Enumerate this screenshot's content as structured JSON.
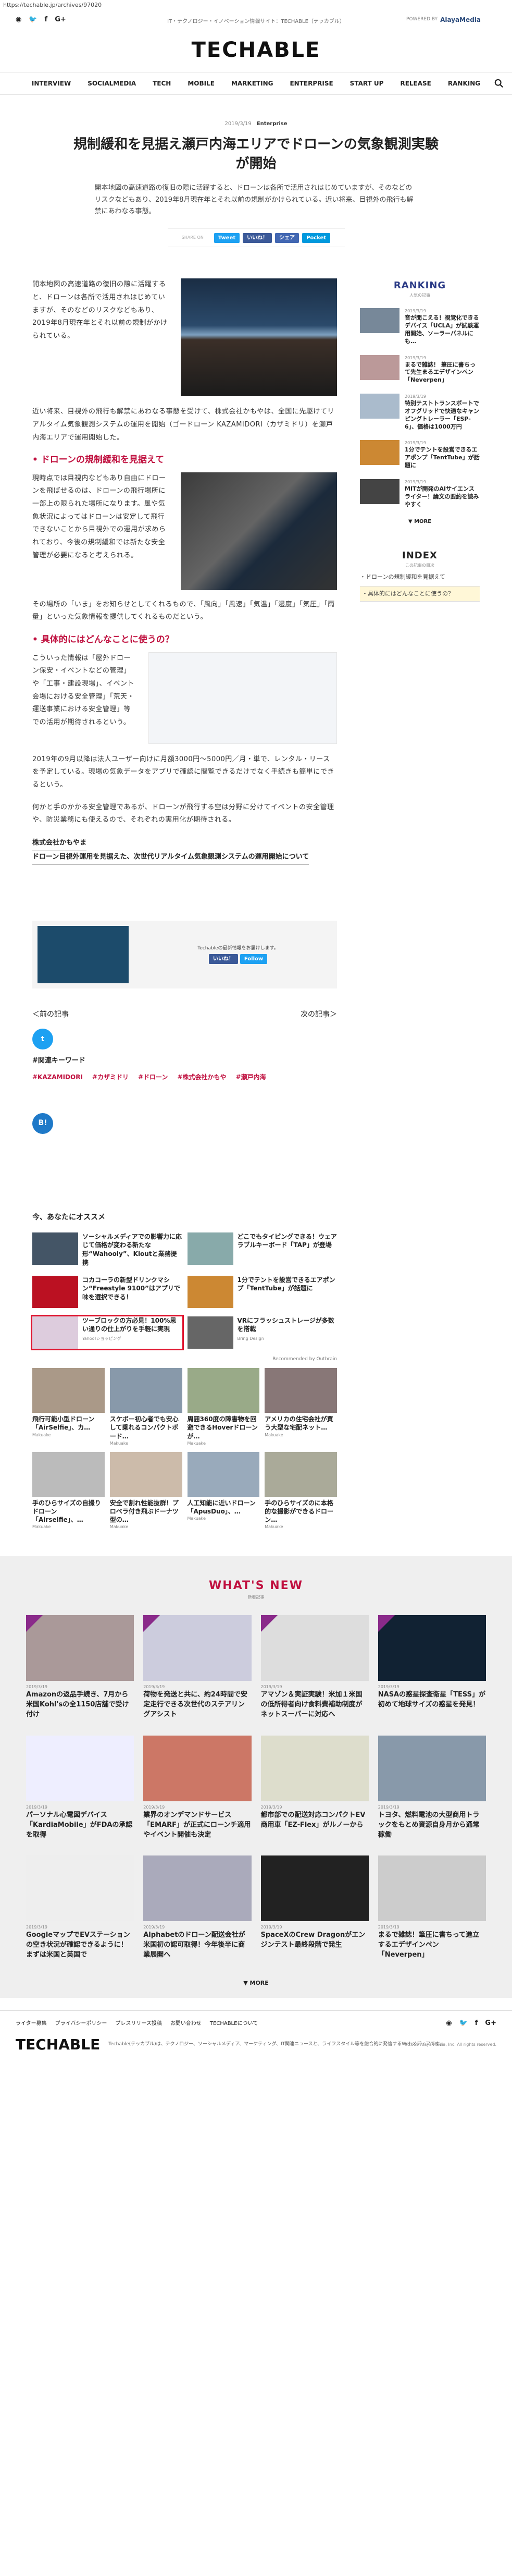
{
  "url": "https://techable.jp/archives/97020",
  "tagline": "IT・テクノロジー・イノベーション情報サイト：TECHABLE（テッカブル）",
  "powered_by": {
    "prefix": "POWERED BY",
    "brand": "AlayaMedia"
  },
  "logo": "TECHABLE",
  "nav": [
    "INTERVIEW",
    "SOCIALMEDIA",
    "TECH",
    "MOBILE",
    "MARKETING",
    "ENTERPRISE",
    "START UP",
    "RELEASE",
    "RANKING"
  ],
  "article": {
    "date": "2019/3/19",
    "category": "Enterprise",
    "title": "規制緩和を見据え瀬戸内海エリアでドローンの気象観測実験が開始",
    "lead": "開本地図の高速道路の復旧の際に活躍すると、ドローンは各所で活用されはじめていますが、そのなどのリスクなどもあり、2019年8月現在年とそれ以前の規制がかけられている。近い将来、目視外の飛行も解禁にあわなる事態。",
    "share_label": "SHARE ON",
    "share_buttons": [
      "Tweet",
      "いいね！",
      "シェア",
      "Pocket"
    ],
    "p1": "開本地図の高速道路の復旧の際に活躍すると、ドローンは各所で活用されはじめていますが、そのなどのリスクなどもあり、2019年8月現在年とそれ以前の規制がかけられている。",
    "p2": "近い将来、目視外の飛行も解禁にあわなる事態を受けて、株式会社かもやは、全国に先駆けてリアルタイム気象観測システムの運用を開始（ゴードローン KAZAMIDORI（カザミドリ）を瀬戸内海エリアで運用開始した。",
    "h2_1": "ドローンの規制緩和を見据えて",
    "p3": "現時点では目視内などもあり自由にドローンを飛ばせるのは、ドローンの飛行場所に一部上の限られた場所になります。風や気象状況によってはドローンは安定して飛行できないことから目視外での運用が求められており、今後の規制緩和では新たな安全管理が必要になると考えられる。",
    "p4": "その場所の「いま」をお知らせとしてくれるもので、「風向」「風速」「気温」「湿度」「気圧」「雨量」といった気象情報を提供してくれるものだという。",
    "h2_2": "具体的にはどんなことに使うの？",
    "p5": "こういった情報は「屋外ドローン保安・イベントなどの管理」や「工事・建設現場」、イベント会場における安全管理」「荒天・運送事業における安全管理」等での活用が期待されるという。",
    "p6": "2019年の9月以降は法人ユーザー向けに月額3000円〜5000円／月・単で、レンタル・リースを予定している。現場の気象データをアプリで確認に閲覧できるだけでなく手続きも簡単にできるという。",
    "p7": "何かと手のかかる安全管理であるが、ドローンが飛行する空は分野に分けてイベントの安全管理や、防災業務にも使えるので、それぞれの実用化が期待される。",
    "source_links": [
      "株式会社かもやま",
      "ドローン目視外運用を見据えた、次世代リアルタイム気象観測システムの運用開始について"
    ],
    "ad_text": "Techableの最新情報をお届けします。",
    "ad_buttons": [
      "いいね！",
      "Follow"
    ],
    "prev": "＜前の記事",
    "next": "次の記事＞",
    "keyword_title": "#関連キーワード",
    "keywords": [
      "#KAZAMIDORI",
      "#カザミドリ",
      "#ドローン",
      "#株式会社かもや",
      "#瀬戸内海"
    ]
  },
  "recommend": {
    "title": "今、あなたにオススメ",
    "items": [
      {
        "title": "ソーシャルメディアでの影響力に応じて価格が変わる新たな形“Wahooly”、Kloutと業務提携",
        "src": ""
      },
      {
        "title": "どこでもタイピングできる！ウェアラブルキーボード「TAP」が登場",
        "src": ""
      },
      {
        "title": "コカコーラの新型ドリンクマシン“Freestyle 9100”はアプリで味を選択できる！",
        "src": ""
      },
      {
        "title": "1分でテントを設営できるエアポンプ「TentTube」が話題に",
        "src": ""
      },
      {
        "title": "ツーブロックの方必見！100%思い通りの仕上がりを手軽に実現",
        "src": "Yahoo!ショッピング"
      },
      {
        "title": "VRにフラッシュストレージが多数を搭載",
        "src": "Bring Design"
      }
    ],
    "outbrain": "Recommended by Outbrain",
    "grid": [
      {
        "title": "飛行可能小型ドローン「AirSelfie」、カ…",
        "src": "Makuake"
      },
      {
        "title": "スケボー初心者でも安心して乗れるコンパクトボード…",
        "src": "Makuake"
      },
      {
        "title": "周囲360度の障害物を回避できるHoverドローンが…",
        "src": "Makuake"
      },
      {
        "title": "アメリカの住宅会社が買う大型な宅配ネット…",
        "src": "Makuake"
      },
      {
        "title": "手のひらサイズの自撮りドローン「Airselfie」、…",
        "src": "Makuake"
      },
      {
        "title": "安全で割れ性能抜群！プロペラ付き飛ぶドーナツ型の…",
        "src": "Makuake"
      },
      {
        "title": "人工知能に近いドローン「ApusDuo」、…",
        "src": "Makuake"
      },
      {
        "title": "手のひらサイズのに本格的な撮影ができるドローン…",
        "src": "Makuake"
      }
    ]
  },
  "ranking": {
    "title": "RANKING",
    "sub": "人気の記事",
    "items": [
      {
        "date": "2019/3/19",
        "title": "音が聞こえる！視覚化できるデバイス「UCLA」が試験運用開始、ソーラーパネルにも…"
      },
      {
        "date": "2019/3/19",
        "title": "まるで雑誌！ 筆圧に書ちって先生まるエデザインペン「Neverpen」"
      },
      {
        "date": "2019/3/19",
        "title": "特別テストトランスポートでオフグリッドで快適なキャンピングトレーラー「ESP-6」、価格は1000万円"
      },
      {
        "date": "2019/3/19",
        "title": "1分でテントを設営できるエアポンプ「TentTube」が話題に"
      },
      {
        "date": "2019/3/19",
        "title": "MITが開発のAIサイエンスライター！論文の要約を読みやすく"
      }
    ],
    "more": "▼ MORE"
  },
  "index": {
    "title": "INDEX",
    "sub": "この記事の目次",
    "items": [
      "・ドローンの規制緩和を見据えて",
      "・具体的にはどんなことに使うの？"
    ]
  },
  "whats_new": {
    "title": "WHAT'S NEW",
    "sub": "新着記事",
    "items": [
      {
        "date": "2019/3/19",
        "title": "Amazonの返品手続き、7月から米国Kohl'sの全1150店舗で受け付け",
        "sub": ""
      },
      {
        "date": "2019/3/19",
        "title": "荷物を発送と共に、約24時間で安定走行できる次世代のステアリングアシスト",
        "sub": ""
      },
      {
        "date": "2019/3/19",
        "title": "アマゾン＆実証実験！米加１米国の低所得者向け食料費補助制度がネットスーパーに対応へ",
        "sub": ""
      },
      {
        "date": "2019/3/19",
        "title": "NASAの惑星探査衛星「TESS」が初めて地球サイズの惑星を発見！",
        "sub": ""
      },
      {
        "date": "2019/3/19",
        "title": "パーソナル心電図デバイス「KardiaMobile」がFDAの承認を取得",
        "sub": ""
      },
      {
        "date": "2019/3/19",
        "title": "業界のオンデマンドサービス「EMARF」が正式にローンチ適用やイベント開催も決定",
        "sub": ""
      },
      {
        "date": "2019/3/19",
        "title": "都市部での配送対応コンパクトEV商用車「EZ-Flex」がルノーから",
        "sub": ""
      },
      {
        "date": "2019/3/19",
        "title": "トヨタ、燃料電池の大型商用トラックをもとめ資源自身月から通常稼働",
        "sub": ""
      },
      {
        "date": "2019/3/19",
        "title": "GoogleマップでEVステーションの空き状況が確認できるように！まずは米国と英国で",
        "sub": ""
      },
      {
        "date": "2019/3/19",
        "title": "Alphabetのドローン配送会社が米国初の認可取得！今年後半に商業展開へ",
        "sub": ""
      },
      {
        "date": "2019/3/19",
        "title": "SpaceXのCrew Dragonがエンジンテスト最終段階で発生",
        "sub": ""
      },
      {
        "date": "2019/3/19",
        "title": "まるで雑誌！筆圧に書ちって進立するエデザインペン「Neverpen」",
        "sub": ""
      }
    ],
    "more": "▼ MORE"
  },
  "footer": {
    "links": [
      "ライター募集",
      "プライバシーポリシー",
      "プレスリリース投稿",
      "お問い合わせ",
      "TECHABLEについて"
    ],
    "logo": "TECHABLE",
    "desc": "Techable(テッカブル)は、テクノロジー、ソーシャルメディア、マーケティング、IT関連ニュースと、ライフスタイル等を総合的に発信するWebメディアです。",
    "copy": "©2019 Alaya Media, Inc. All rights reserved."
  }
}
